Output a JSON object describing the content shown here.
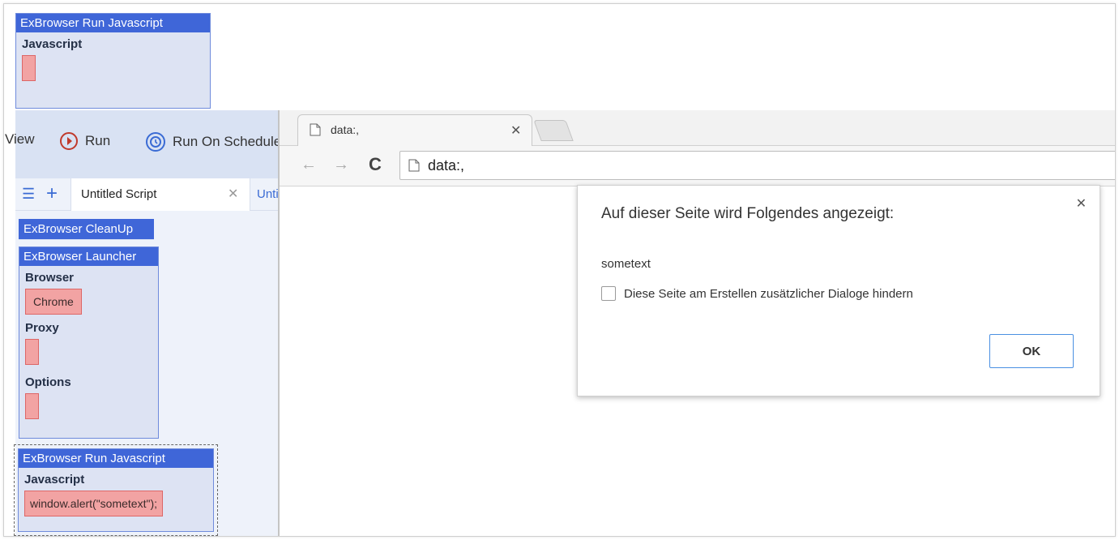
{
  "top_block": {
    "title": "ExBrowser Run Javascript",
    "field_label": "Javascript"
  },
  "toolbar": {
    "view_label": "View",
    "run_label": "Run",
    "schedule_label": "Run On Schedule"
  },
  "tabs": {
    "active_label": "Untitled Script",
    "second_label": "Untitled"
  },
  "cleanup_block": {
    "title": "ExBrowser CleanUp"
  },
  "launcher_block": {
    "title": "ExBrowser Launcher",
    "browser_label": "Browser",
    "browser_value": "Chrome",
    "proxy_label": "Proxy",
    "options_label": "Options"
  },
  "run_js_block": {
    "title": "ExBrowser Run Javascript",
    "field_label": "Javascript",
    "code": "window.alert(\"sometext\");"
  },
  "browser": {
    "tab_title": "data:,",
    "url": "data:,"
  },
  "dialog": {
    "title": "Auf dieser Seite wird Folgendes angezeigt:",
    "message": "sometext",
    "checkbox_label": "Diese Seite am Erstellen zusätzlicher Dialoge hindern",
    "ok_label": "OK"
  },
  "colors": {
    "block_header": "#3f66d8",
    "block_body": "#dde3f3",
    "slot": "#f2a3a3",
    "toolbar_bg": "#d9e2f3",
    "run_icon": "#c0392b",
    "schedule_icon": "#3a6bd4"
  }
}
